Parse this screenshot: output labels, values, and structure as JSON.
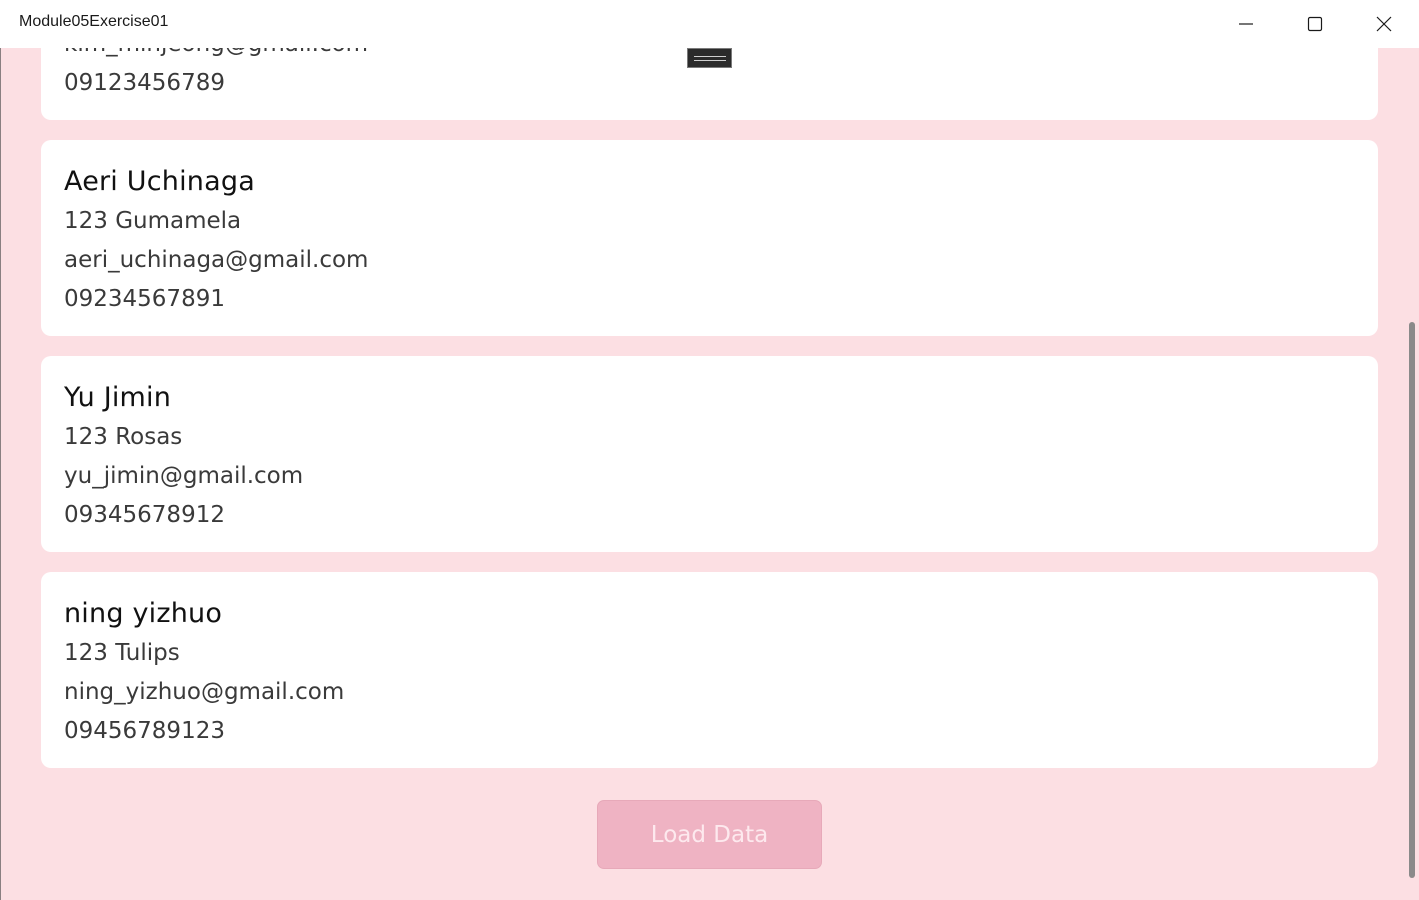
{
  "window": {
    "title": "Module05Exercise01",
    "controls": [
      "minimize-icon",
      "maximize-icon",
      "close-icon"
    ]
  },
  "contacts": [
    {
      "name": "",
      "address": "",
      "email": "kim_minjeong@gmail.com",
      "phone": "09123456789"
    },
    {
      "name": "Aeri Uchinaga",
      "address": "123 Gumamela",
      "email": "aeri_uchinaga@gmail.com",
      "phone": "09234567891"
    },
    {
      "name": "Yu Jimin",
      "address": "123 Rosas",
      "email": "yu_jimin@gmail.com",
      "phone": "09345678912"
    },
    {
      "name": "ning yizhuo",
      "address": "123 Tulips",
      "email": "ning_yizhuo@gmail.com",
      "phone": "09456789123"
    }
  ],
  "load_button_label": "Load Data",
  "colors": {
    "page_background": "#fcdfe3",
    "card_background": "#ffffff",
    "button_background": "#efb3c3",
    "button_text": "#fde9ee"
  }
}
